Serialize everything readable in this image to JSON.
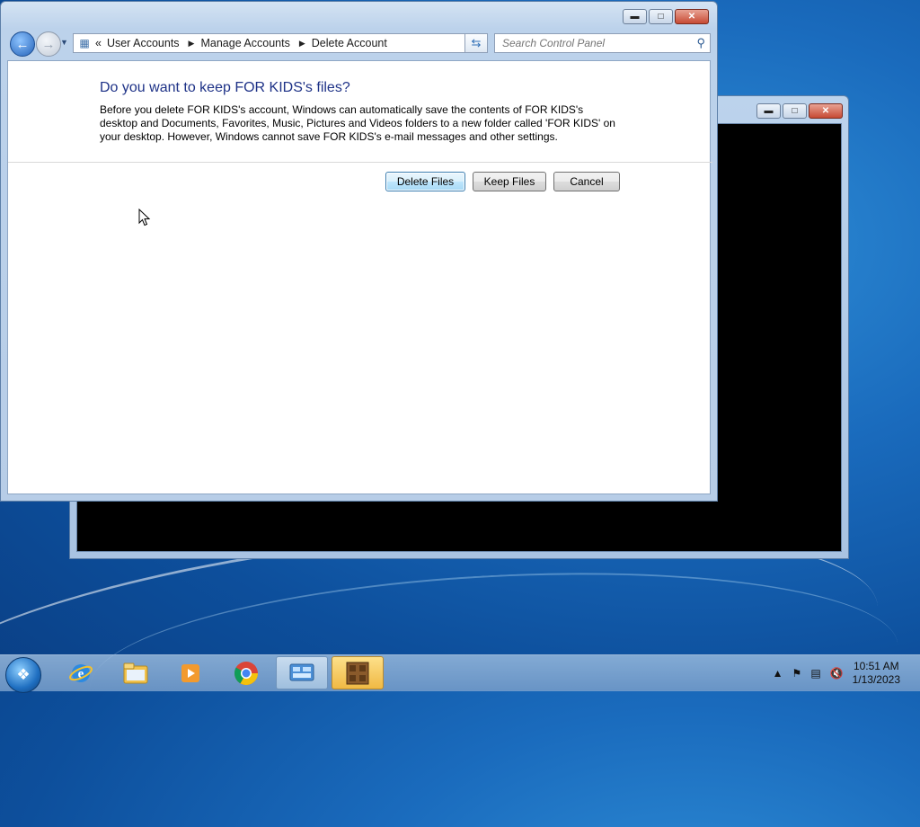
{
  "main_window": {
    "breadcrumb": {
      "overflow": "«",
      "items": [
        "User Accounts",
        "Manage Accounts",
        "Delete Account"
      ]
    },
    "search": {
      "placeholder": "Search Control Panel"
    },
    "heading": "Do you want to keep FOR KIDS's files?",
    "body": "Before you delete FOR KIDS's account, Windows can automatically save the contents of FOR KIDS's desktop and Documents, Favorites, Music, Pictures and Videos folders to a new folder called 'FOR KIDS' on your desktop. However, Windows cannot save FOR KIDS's e-mail messages and other settings.",
    "buttons": {
      "delete_files": "Delete Files",
      "keep_files": "Keep Files",
      "cancel": "Cancel"
    }
  },
  "taskbar": {
    "items": [
      {
        "name": "internet-explorer-icon"
      },
      {
        "name": "file-explorer-icon"
      },
      {
        "name": "media-player-icon"
      },
      {
        "name": "chrome-icon"
      },
      {
        "name": "control-panel-icon",
        "active": true
      },
      {
        "name": "minecraft-icon",
        "highlighted": true
      }
    ],
    "clock": {
      "time": "10:51 AM",
      "date": "1/13/2023"
    }
  },
  "colors": {
    "heading": "#1e3287",
    "desktop": "#1a6bbd",
    "default_button_border": "#3c7fb1"
  }
}
